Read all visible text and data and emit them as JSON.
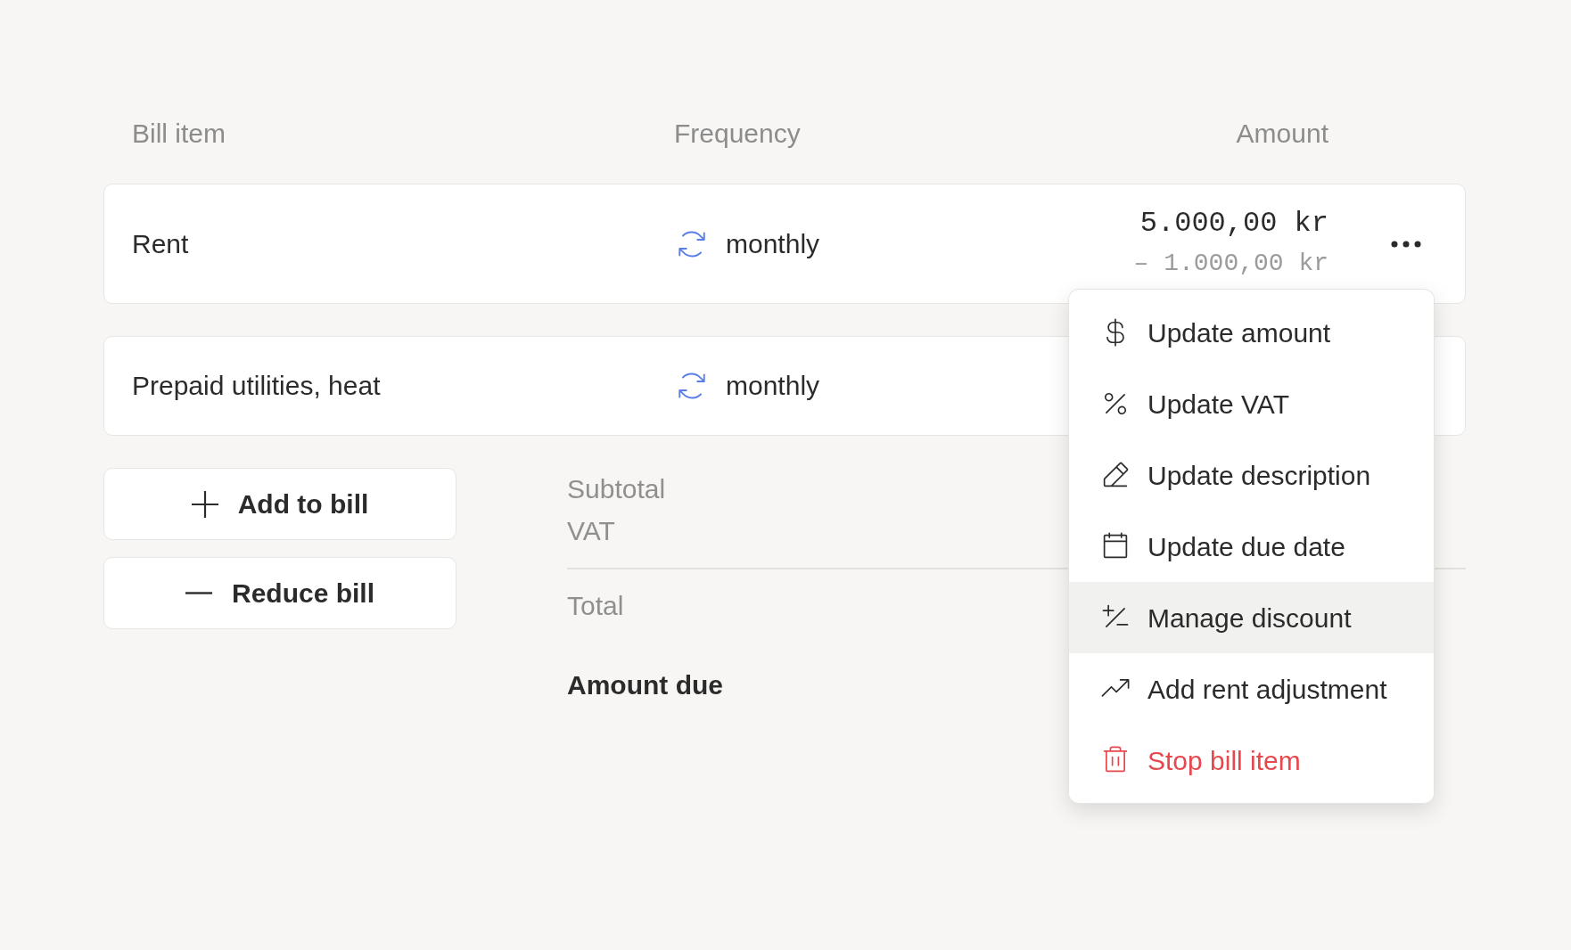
{
  "table": {
    "columns": [
      "Bill item",
      "Frequency",
      "Amount"
    ],
    "rows": [
      {
        "item": "Rent",
        "frequency": "monthly",
        "amount": "5.000,00 kr",
        "adjustment": "– 1.000,00 kr"
      },
      {
        "item": "Prepaid utilities, heat",
        "frequency": "monthly"
      }
    ]
  },
  "buttons": [
    {
      "label": "Add to bill"
    },
    {
      "label": "Reduce bill"
    }
  ],
  "summary": {
    "lines": [
      "Subtotal",
      "VAT"
    ],
    "total": "Total",
    "amount_due": "Amount due"
  },
  "context_menu": {
    "items": [
      {
        "label": "Update amount",
        "kind": "action",
        "selected": false
      },
      {
        "label": "Update VAT",
        "kind": "action",
        "selected": false
      },
      {
        "label": "Update description",
        "kind": "action",
        "selected": false
      },
      {
        "label": "Update due date",
        "kind": "action",
        "selected": false
      },
      {
        "label": "Manage discount",
        "kind": "action",
        "selected": true
      },
      {
        "label": "Add rent adjustment",
        "kind": "action",
        "selected": false
      },
      {
        "label": "Stop bill item",
        "kind": "danger",
        "selected": false
      }
    ]
  }
}
